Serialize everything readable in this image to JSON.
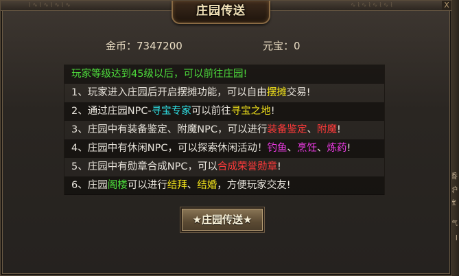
{
  "window": {
    "title": "庄园传送",
    "close_glyph": "X"
  },
  "currency": {
    "gold_label": "金币：7347200",
    "yuanbao_label": "元宝：0"
  },
  "intro": "玩家等级达到45级以后，可以前往庄园!",
  "rules": [
    [
      {
        "text": "1、玩家进入庄园后开启摆摊功能，可以自由",
        "color": "white"
      },
      {
        "text": "摆摊",
        "color": "yellow"
      },
      {
        "text": "交易!",
        "color": "white"
      }
    ],
    [
      {
        "text": "2、通过庄园NPC-",
        "color": "white"
      },
      {
        "text": "寻宝专家",
        "color": "cyan"
      },
      {
        "text": "可以前往",
        "color": "white"
      },
      {
        "text": "寻宝之地",
        "color": "yellow"
      },
      {
        "text": "!",
        "color": "white"
      }
    ],
    [
      {
        "text": "3、庄园中有装备鉴定、附魔NPC，可以进行",
        "color": "white"
      },
      {
        "text": "装备鉴定",
        "color": "red"
      },
      {
        "text": "、",
        "color": "white"
      },
      {
        "text": "附魔",
        "color": "red"
      },
      {
        "text": "!",
        "color": "white"
      }
    ],
    [
      {
        "text": "4、庄园中有休闲NPC，可以探索休闲活动！",
        "color": "white"
      },
      {
        "text": "钓鱼",
        "color": "magenta"
      },
      {
        "text": "、",
        "color": "white"
      },
      {
        "text": "烹饪",
        "color": "magenta"
      },
      {
        "text": "、",
        "color": "white"
      },
      {
        "text": "炼药",
        "color": "magenta"
      },
      {
        "text": "!",
        "color": "white"
      }
    ],
    [
      {
        "text": "5、庄园中有勋章合成NPC，可以",
        "color": "white"
      },
      {
        "text": "合成荣誉勋章",
        "color": "red"
      },
      {
        "text": "!",
        "color": "white"
      }
    ],
    [
      {
        "text": "6、庄园",
        "color": "white"
      },
      {
        "text": "阁楼",
        "color": "green"
      },
      {
        "text": "可以进行",
        "color": "white"
      },
      {
        "text": "结拜",
        "color": "yellow"
      },
      {
        "text": "、",
        "color": "white"
      },
      {
        "text": "结婚",
        "color": "yellow"
      },
      {
        "text": "，方便玩家交友!",
        "color": "white"
      }
    ]
  ],
  "button": {
    "teleport_label": "★庄园传送★"
  },
  "background_side_text": [
    "香",
    "炉",
    "蓝宝石",
    "名气",
    "I"
  ],
  "colors": {
    "green": "#4ddc3c",
    "yellow": "#f2e21a",
    "cyan": "#2fe3e8",
    "red": "#ff3a3a",
    "magenta": "#f03ae8",
    "white": "#e8e4dc"
  }
}
